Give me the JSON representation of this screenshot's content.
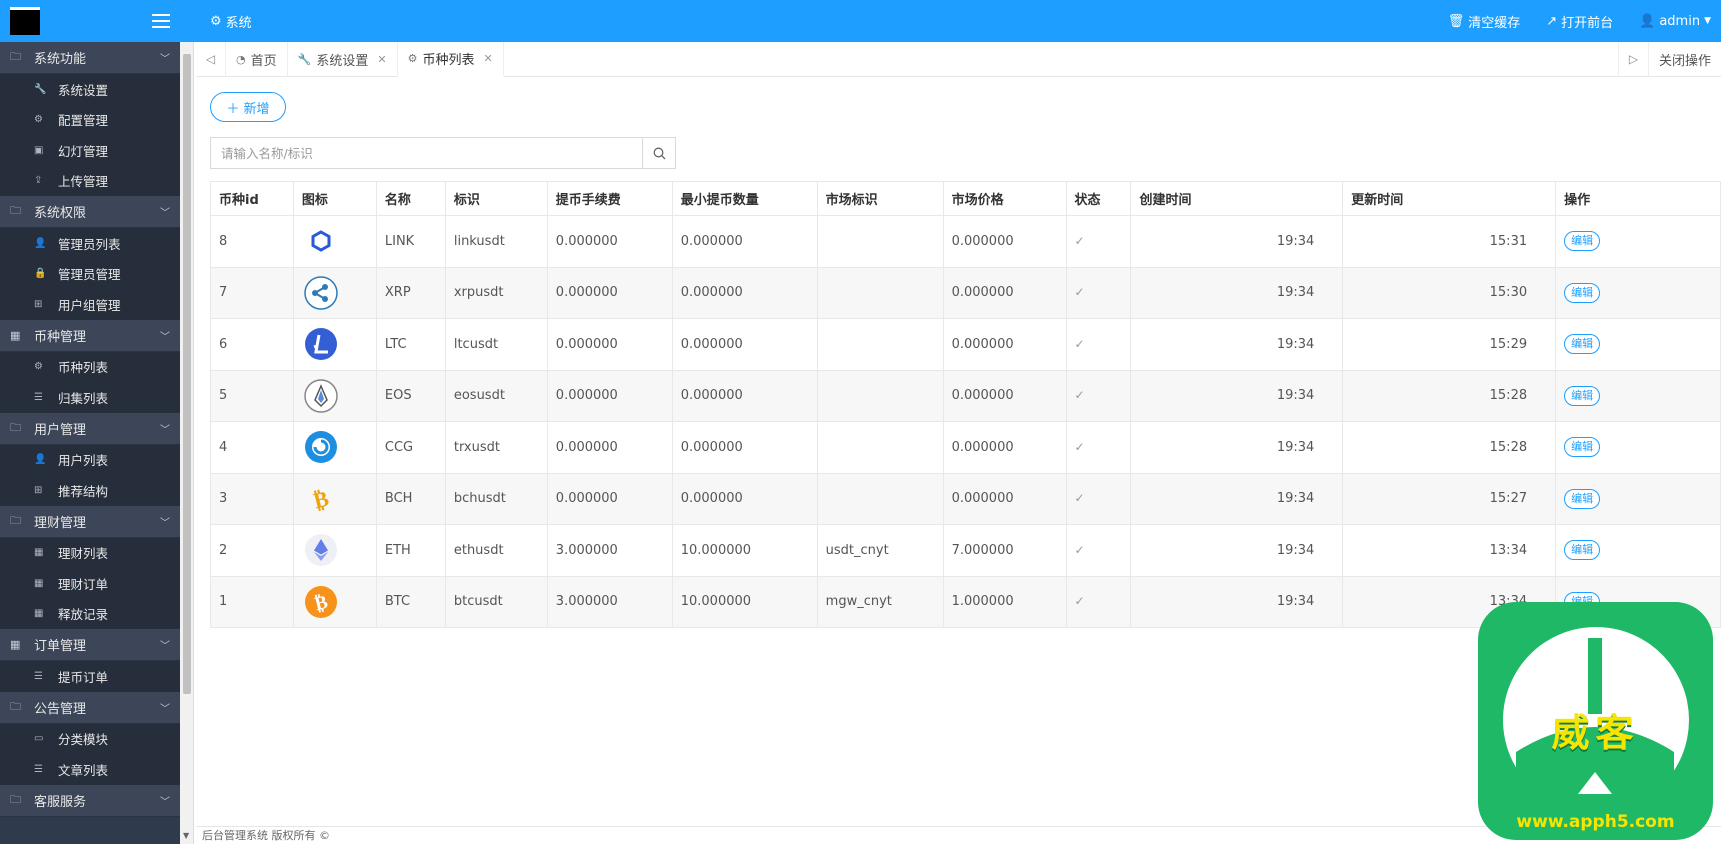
{
  "header": {
    "system_label": "系统",
    "clear_cache": "清空缓存",
    "open_frontend": "打开前台",
    "user": "admin"
  },
  "sidebar": {
    "groups": [
      {
        "label": "系统功能",
        "icon": "folder-icon",
        "items": [
          {
            "label": "系统设置",
            "icon": "wrench-icon"
          },
          {
            "label": "配置管理",
            "icon": "gears-icon"
          },
          {
            "label": "幻灯管理",
            "icon": "image-icon"
          },
          {
            "label": "上传管理",
            "icon": "upload-icon"
          }
        ]
      },
      {
        "label": "系统权限",
        "icon": "folder-icon",
        "items": [
          {
            "label": "管理员列表",
            "icon": "user-icon"
          },
          {
            "label": "管理员管理",
            "icon": "lock-icon"
          },
          {
            "label": "用户组管理",
            "icon": "sitemap-icon"
          }
        ]
      },
      {
        "label": "币种管理",
        "icon": "grid-icon",
        "items": [
          {
            "label": "币种列表",
            "icon": "gears-icon"
          },
          {
            "label": "归集列表",
            "icon": "list-icon"
          }
        ]
      },
      {
        "label": "用户管理",
        "icon": "folder-icon",
        "items": [
          {
            "label": "用户列表",
            "icon": "user-icon"
          },
          {
            "label": "推荐结构",
            "icon": "sitemap-icon"
          }
        ]
      },
      {
        "label": "理财管理",
        "icon": "folder-icon",
        "items": [
          {
            "label": "理财列表",
            "icon": "grid-icon"
          },
          {
            "label": "理财订单",
            "icon": "grid-icon"
          },
          {
            "label": "释放记录",
            "icon": "grid-icon"
          }
        ]
      },
      {
        "label": "订单管理",
        "icon": "grid-icon",
        "items": [
          {
            "label": "提币订单",
            "icon": "list-icon"
          }
        ]
      },
      {
        "label": "公告管理",
        "icon": "folder-icon",
        "items": [
          {
            "label": "分类模块",
            "icon": "inbox-icon"
          },
          {
            "label": "文章列表",
            "icon": "list-icon"
          }
        ]
      },
      {
        "label": "客服服务",
        "icon": "folder-icon",
        "items": []
      }
    ]
  },
  "tabs": {
    "items": [
      {
        "label": "首页",
        "icon": "dashboard-icon",
        "closable": false
      },
      {
        "label": "系统设置",
        "icon": "wrench-icon",
        "closable": true
      },
      {
        "label": "币种列表",
        "icon": "gears-icon",
        "closable": true
      }
    ],
    "close_ops": "关闭操作"
  },
  "toolbar": {
    "add_label": "新增",
    "search_placeholder": "请输入名称/标识"
  },
  "table": {
    "columns": [
      "币种id",
      "图标",
      "名称",
      "标识",
      "提币手续费",
      "最小提币数量",
      "市场标识",
      "市场价格",
      "状态",
      "创建时间",
      "更新时间",
      "操作"
    ],
    "rows": [
      {
        "id": "8",
        "icon": "link-coin",
        "color": "#2a5ada",
        "name": "LINK",
        "symbol": "linkusdt",
        "fee": "0.000000",
        "min": "0.000000",
        "market": "",
        "price": "0.000000",
        "created": "19:34",
        "updated": "15:31",
        "action": "编辑"
      },
      {
        "id": "7",
        "icon": "xrp-coin",
        "color": "#2b7bb9",
        "name": "XRP",
        "symbol": "xrpusdt",
        "fee": "0.000000",
        "min": "0.000000",
        "market": "",
        "price": "0.000000",
        "created": "19:34",
        "updated": "15:30",
        "action": "编辑"
      },
      {
        "id": "6",
        "icon": "ltc-coin",
        "color": "#345ed4",
        "name": "LTC",
        "symbol": "ltcusdt",
        "fee": "0.000000",
        "min": "0.000000",
        "market": "",
        "price": "0.000000",
        "created": "19:34",
        "updated": "15:29",
        "action": "编辑"
      },
      {
        "id": "5",
        "icon": "eos-coin",
        "color": "#555555",
        "name": "EOS",
        "symbol": "eosusdt",
        "fee": "0.000000",
        "min": "0.000000",
        "market": "",
        "price": "0.000000",
        "created": "19:34",
        "updated": "15:28",
        "action": "编辑"
      },
      {
        "id": "4",
        "icon": "ccg-coin",
        "color": "#1e8fe0",
        "name": "CCG",
        "symbol": "trxusdt",
        "fee": "0.000000",
        "min": "0.000000",
        "market": "",
        "price": "0.000000",
        "created": "19:34",
        "updated": "15:28",
        "action": "编辑"
      },
      {
        "id": "3",
        "icon": "bch-coin",
        "color": "#f0a30a",
        "name": "BCH",
        "symbol": "bchusdt",
        "fee": "0.000000",
        "min": "0.000000",
        "market": "",
        "price": "0.000000",
        "created": "19:34",
        "updated": "15:27",
        "action": "编辑"
      },
      {
        "id": "2",
        "icon": "eth-coin",
        "color": "#627eea",
        "name": "ETH",
        "symbol": "ethusdt",
        "fee": "3.000000",
        "min": "10.000000",
        "market": "usdt_cnyt",
        "price": "7.000000",
        "created": "19:34",
        "updated": "13:34",
        "action": "编辑"
      },
      {
        "id": "1",
        "icon": "btc-coin",
        "color": "#f7931a",
        "name": "BTC",
        "symbol": "btcusdt",
        "fee": "3.000000",
        "min": "10.000000",
        "market": "mgw_cnyt",
        "price": "1.000000",
        "created": "19:34",
        "updated": "13:34",
        "action": "编辑"
      }
    ]
  },
  "footer": {
    "text": "后台管理系统 版权所有 ©"
  },
  "watermark": {
    "title": "威客",
    "url": "www.apph5.com"
  },
  "colors": {
    "primary": "#1e9fff",
    "sidebar": "#2f3a4c",
    "badge": "#1fb866"
  }
}
